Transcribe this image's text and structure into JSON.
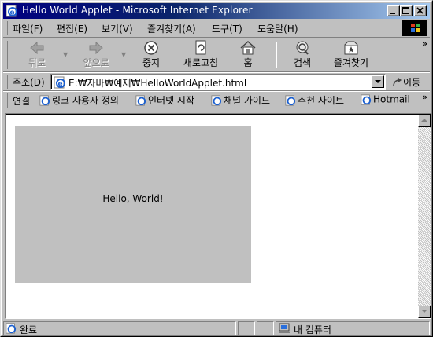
{
  "window": {
    "title": "Hello World Applet - Microsoft Internet Explorer"
  },
  "menu": {
    "items": [
      "파일(F)",
      "편집(E)",
      "보기(V)",
      "즐겨찾기(A)",
      "도구(T)",
      "도움말(H)"
    ]
  },
  "toolbar": {
    "back": "뒤로",
    "forward": "앞으로",
    "stop": "중지",
    "refresh": "새로고침",
    "home": "홈",
    "search": "검색",
    "favorites": "즐겨찾기",
    "more": "»"
  },
  "address": {
    "label": "주소(D)",
    "value": "E:₩자바₩예제₩HelloWorldApplet.html",
    "go": "이동"
  },
  "links": {
    "label": "연결",
    "items": [
      "링크 사용자 정의",
      "인터넷 시작",
      "채널 가이드",
      "추천 사이트",
      "Hotmail"
    ],
    "more": "»"
  },
  "applet": {
    "text": "Hello, World!"
  },
  "status": {
    "text": "완료",
    "zone": "내 컴퓨터"
  },
  "colors": {
    "title_start": "#000080",
    "title_end": "#a6caf0",
    "chrome": "#c0c0c0",
    "applet_bg": "#c0c0c0"
  },
  "icons": [
    "ie-page-icon",
    "minimize-icon",
    "maximize-icon",
    "close-icon",
    "back-arrow-icon",
    "forward-arrow-icon",
    "stop-icon",
    "refresh-icon",
    "home-icon",
    "search-icon",
    "favorites-icon",
    "go-arrow-icon",
    "windows-logo-icon",
    "my-computer-icon"
  ]
}
